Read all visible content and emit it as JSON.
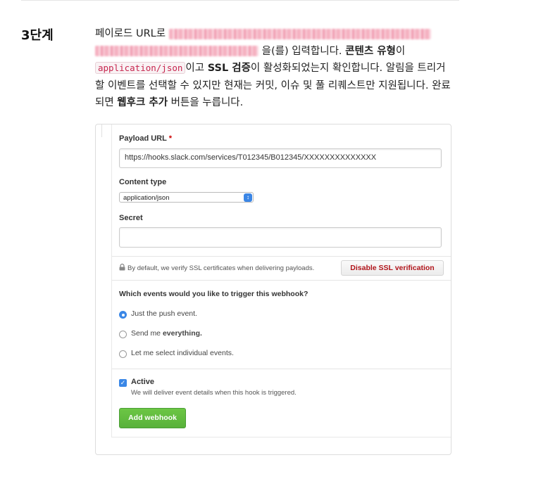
{
  "step": {
    "label": "3단계"
  },
  "paragraph": {
    "part1": "페이로드 URL로 ",
    "part2": "을(를) 입력합니다. ",
    "content_type_bold": "콘텐츠 유형",
    "part3": "이 ",
    "code_json": "application/json",
    "part4": "이고 ",
    "ssl_bold": "SSL 검증",
    "part5": "이 활성화되었는지 확인합니다. 알림을 트리거할 이벤트를 선택할 수 있지만 현재는 커밋, 이슈 및 풀 리퀘스트만 지원됩니다. 완료되면 ",
    "add_webhook_bold": "웹후크 추가",
    "part6": " 버튼을 누릅니다."
  },
  "form": {
    "payload_label": "Payload URL",
    "required_mark": "*",
    "payload_value": "https://hooks.slack.com/services/T012345/B012345/XXXXXXXXXXXXXX",
    "content_type_label": "Content type",
    "content_type_value": "application/json",
    "secret_label": "Secret",
    "secret_value": "",
    "ssl_note": "By default, we verify SSL certificates when delivering payloads.",
    "disable_ssl_button": "Disable SSL verification",
    "events_question": "Which events would you like to trigger this webhook?",
    "option_push": "Just the push event.",
    "option_everything_prefix": "Send me ",
    "option_everything_bold": "everything.",
    "option_individual": "Let me select individual events.",
    "selected_option": "push",
    "active_label": "Active",
    "active_checked": true,
    "active_desc": "We will deliver event details when this hook is triggered.",
    "add_webhook_button": "Add webhook"
  },
  "colors": {
    "accent_blue": "#3a87e6",
    "button_green": "#6cc644",
    "danger_text": "#b1151b",
    "code_text": "#c7254e"
  },
  "icons": {
    "lock": "lock-icon",
    "select_arrows": "select-arrows-icon",
    "check": "checkmark-icon"
  }
}
